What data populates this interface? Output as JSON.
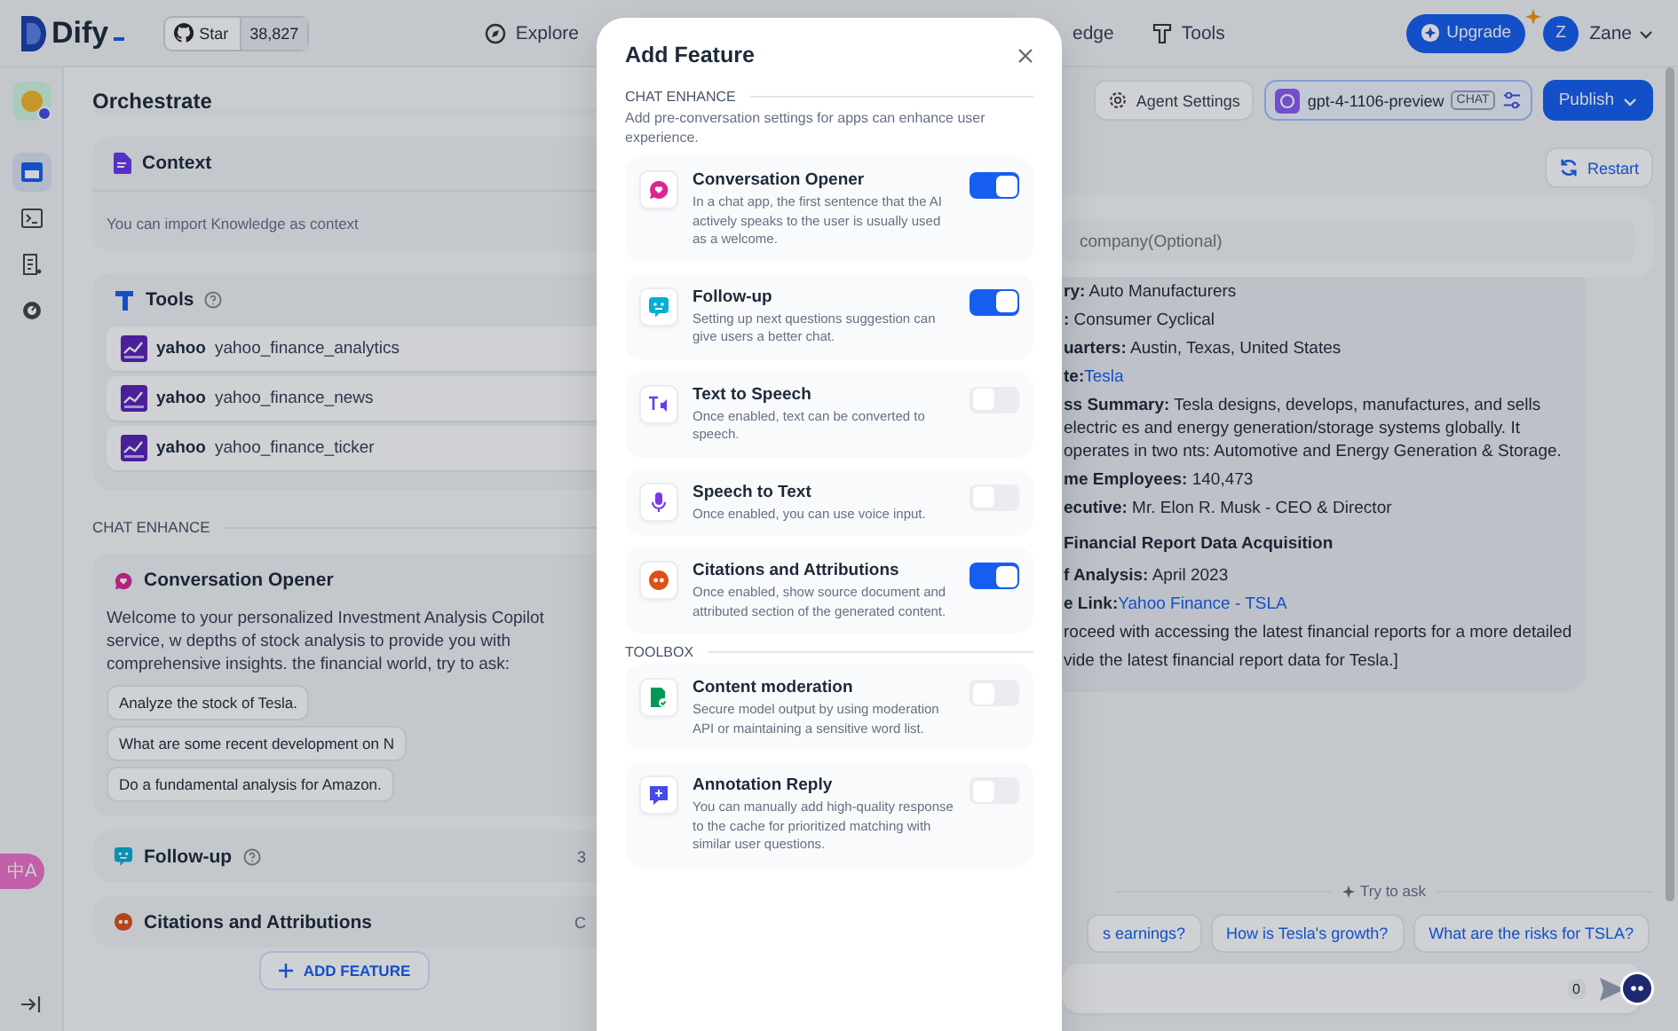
{
  "header": {
    "logo": "Dify",
    "github": {
      "label": "Star",
      "count": "38,827"
    },
    "nav_left": [
      {
        "label": "Explore",
        "kind": "explore"
      }
    ],
    "nav_right": [
      {
        "label": "edge",
        "kind": "plain"
      },
      {
        "label": "Tools",
        "kind": "tools"
      }
    ],
    "upgrade": "Upgrade",
    "user": {
      "initial": "Z",
      "name": "Zane"
    }
  },
  "sidebar": {
    "items": [
      {
        "kind": "layout",
        "selected": true
      },
      {
        "kind": "terminal",
        "selected": false
      },
      {
        "kind": "document",
        "selected": false
      },
      {
        "kind": "gauge",
        "selected": false
      }
    ]
  },
  "orchestrate": {
    "title": "Orchestrate",
    "context": {
      "title": "Context",
      "hint": "You can import Knowledge as context"
    },
    "tools": {
      "title": "Tools",
      "items": [
        {
          "provider": "yahoo",
          "name": "yahoo_finance_analytics"
        },
        {
          "provider": "yahoo",
          "name": "yahoo_finance_news"
        },
        {
          "provider": "yahoo",
          "name": "yahoo_finance_ticker"
        }
      ]
    },
    "chat_enhance": {
      "heading": "CHAT ENHANCE",
      "opener": {
        "kind": "opener",
        "title": "Conversation Opener",
        "text": "Welcome to your personalized Investment Analysis Copilot service, w depths of stock analysis to provide you with comprehensive insights. the financial world, try to ask:",
        "questions": [
          "Analyze the stock of Tesla.",
          "What are some recent development on N",
          "Do a fundamental analysis for Amazon."
        ]
      },
      "rows": [
        {
          "kind": "followup",
          "title": "Follow-up",
          "help": true,
          "value": "3"
        },
        {
          "kind": "citation",
          "title": "Citations and Attributions",
          "help": false,
          "value": "C"
        }
      ]
    },
    "add_feature": "ADD FEATURE",
    "translate": "中A"
  },
  "toolbar": {
    "agent_settings": "Agent Settings",
    "model": "gpt-4-1106-preview",
    "model_tag": "CHAT",
    "publish": "Publish"
  },
  "preview": {
    "restart": "Restart",
    "input_placeholder": "company(Optional)",
    "message": [
      {
        "kind": "line",
        "text": "**ry:** Auto Manufacturers"
      },
      {
        "kind": "line",
        "text": "**:** Consumer Cyclical"
      },
      {
        "kind": "line",
        "text": "**uarters:** Austin, Texas, United States"
      },
      {
        "kind": "line",
        "text": "**te:**",
        "link": "Tesla"
      },
      {
        "kind": "line",
        "text": "**ss Summary:** Tesla designs, develops, manufactures, and sells electric es and energy generation/storage systems globally. It operates in two nts: Automotive and Energy Generation & Storage."
      },
      {
        "kind": "line",
        "text": "**me Employees:** 140,473"
      },
      {
        "kind": "line",
        "text": "**ecutive:** Mr. Elon R. Musk - CEO & Director"
      },
      {
        "kind": "heading",
        "text": "Financial Report Data Acquisition"
      },
      {
        "kind": "line",
        "text": "**f Analysis:** April 2023"
      },
      {
        "kind": "line",
        "text": "**e Link:**",
        "link": "Yahoo Finance - TSLA"
      },
      {
        "kind": "line",
        "text": "roceed with accessing the latest financial reports for a more detailed"
      },
      {
        "kind": "line",
        "text": "vide the latest financial report data for Tesla.]"
      }
    ],
    "try_to_ask": "Try to ask",
    "suggestions": [
      "s earnings?",
      "How is Tesla's growth?",
      "What are the risks for TSLA?"
    ],
    "char_count": "0"
  },
  "modal": {
    "title": "Add Feature",
    "sections": [
      {
        "heading": "CHAT ENHANCE",
        "description": "Add pre-conversation settings for apps can enhance user experience.",
        "items": [
          {
            "kind": "opener",
            "title": "Conversation Opener",
            "description": "In a chat app, the first sentence that the AI actively speaks to the user is usually used as a welcome.",
            "on": true
          },
          {
            "kind": "followup",
            "title": "Follow-up",
            "description": "Setting up next questions suggestion can give users a better chat.",
            "on": true
          },
          {
            "kind": "tts",
            "title": "Text to Speech",
            "description": "Once enabled, text can be converted to speech.",
            "on": false
          },
          {
            "kind": "stt",
            "title": "Speech to Text",
            "description": "Once enabled, you can use voice input.",
            "on": false
          },
          {
            "kind": "citation",
            "title": "Citations and Attributions",
            "description": "Once enabled, show source document and attributed section of the generated content.",
            "on": true
          }
        ]
      },
      {
        "heading": "TOOLBOX",
        "items": [
          {
            "kind": "moderation",
            "title": "Content moderation",
            "description": "Secure model output by using moderation API or maintaining a sensitive word list.",
            "on": false
          },
          {
            "kind": "annotation",
            "title": "Annotation Reply",
            "description": "You can manually add high-quality response to the cache for prioritized matching with similar user questions.",
            "on": false
          }
        ]
      }
    ]
  }
}
